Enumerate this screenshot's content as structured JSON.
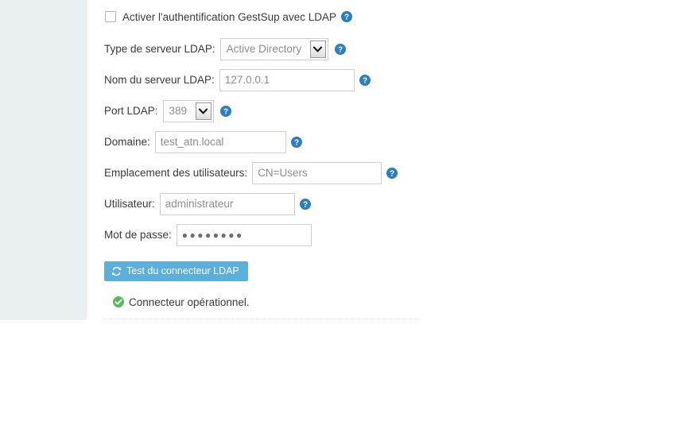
{
  "sidebar": {
    "background_color": "#eaeff2"
  },
  "form": {
    "enable_checkbox": {
      "label": "Activer l'authentification GestSup avec LDAP",
      "checked": false,
      "help_icon": "help-circle-icon"
    },
    "fields": [
      {
        "label": "Type de serveur LDAP:",
        "control": "select",
        "value": "Active Directory",
        "options": [
          "Active Directory"
        ],
        "help_icon": "help-circle-icon"
      },
      {
        "label": "Nom du serveur LDAP:",
        "control": "text",
        "value": "127.0.0.1",
        "placeholder": "127.0.0.1",
        "help_icon": "help-circle-icon"
      },
      {
        "label": "Port LDAP:",
        "control": "select",
        "value": "389",
        "options": [
          "389"
        ],
        "help_icon": "help-circle-icon"
      },
      {
        "label": "Domaine:",
        "control": "text",
        "value": "test_atn.local",
        "placeholder": "test_atn.local",
        "help_icon": "help-circle-icon"
      },
      {
        "label": "Emplacement des utilisateurs:",
        "control": "text",
        "value": "CN=Users",
        "placeholder": "CN=Users",
        "help_icon": "help-circle-icon"
      },
      {
        "label": "Utilisateur:",
        "control": "text",
        "value": "administrateur",
        "placeholder": "administrateur",
        "help_icon": "help-circle-icon"
      },
      {
        "label": "Mot de passe:",
        "control": "password",
        "value": "●●●●●●●●",
        "placeholder": "",
        "help_icon": null
      }
    ],
    "test_button": {
      "label": "Test du connecteur LDAP",
      "icon": "refresh-icon",
      "background_color": "#5bafdb",
      "text_color": "#ffffff"
    },
    "status": {
      "text": "Connecteur opérationnel.",
      "icon": "check-circle-icon",
      "icon_color": "#5cb85c"
    }
  },
  "colors": {
    "accent_blue": "#2b7fc1",
    "button_blue": "#5bafdb",
    "success_green": "#5cb85c",
    "sidebar_gray": "#eaeff2",
    "input_border": "#cfcfcf",
    "placeholder_text": "#8d8d8d"
  }
}
